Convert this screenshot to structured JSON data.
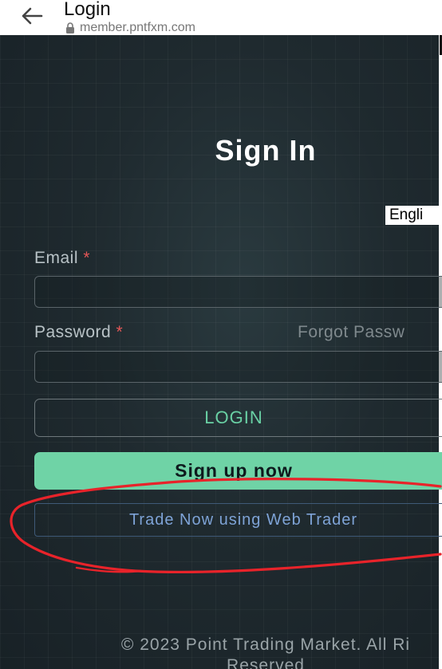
{
  "browser": {
    "title": "Login",
    "url": "member.pntfxm.com"
  },
  "signin": {
    "title": "Sign In",
    "language": "Engli"
  },
  "form": {
    "email_label": "Email",
    "email_value": "",
    "password_label": "Password",
    "password_value": "",
    "required_mark": "*",
    "forgot_label": "Forgot Passw"
  },
  "buttons": {
    "login": "LOGIN",
    "signup": "Sign up now",
    "webtrader": "Trade Now using Web Trader"
  },
  "footer": {
    "line1": "© 2023 Point Trading Market. All Ri",
    "line2": "Reserved"
  },
  "colors": {
    "accent": "#6fd3a6",
    "background": "#1f2a2f",
    "link": "#7ea3d6",
    "required": "#e45757",
    "annotation": "#e8232a"
  },
  "icons": {
    "back": "back-arrow-icon",
    "lock": "lock-icon"
  }
}
